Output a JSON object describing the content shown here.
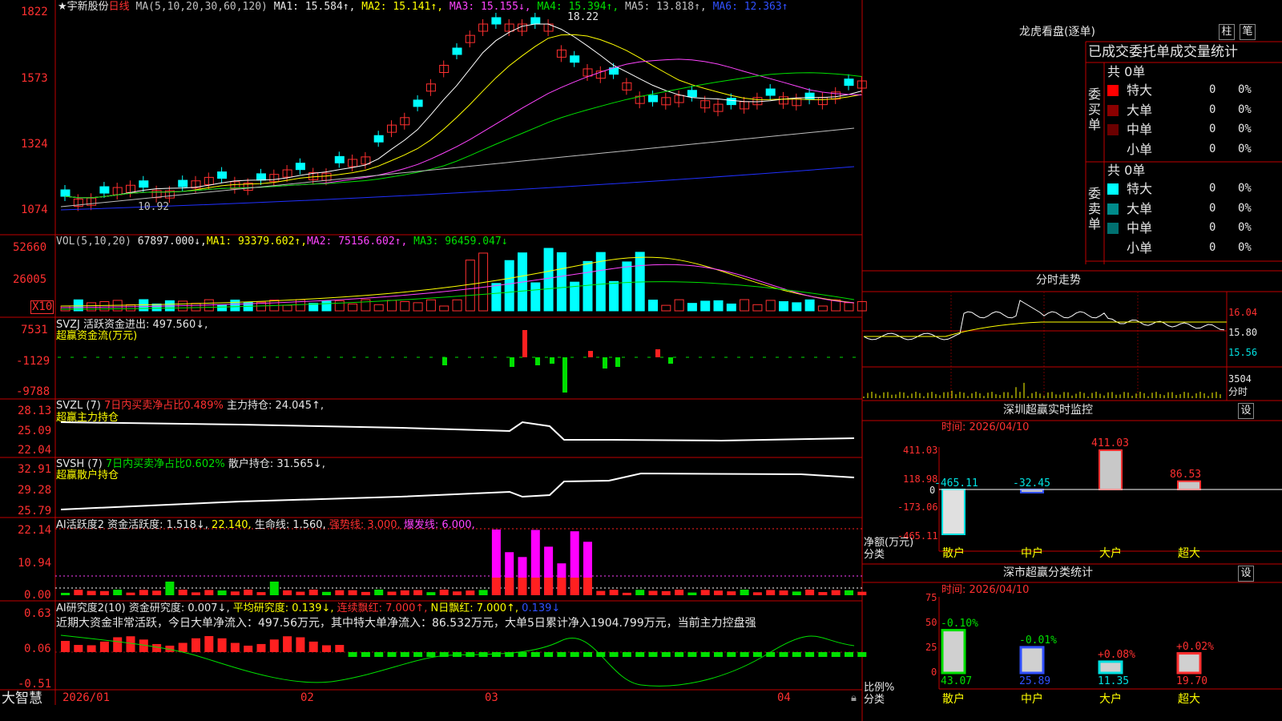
{
  "stock": {
    "name": "★宇新股份",
    "period": "日线",
    "ma_header": "MA(5,10,20,30,60,120)",
    "ma1": "MA1: 15.584↑,",
    "ma2": "MA2: 15.141↑,",
    "ma3": "MA3: 15.155↓,",
    "ma4": "MA4: 15.394↑,",
    "ma5": "MA5: 13.818↑,",
    "ma6": "MA6: 12.363↑",
    "high_label": "18.22",
    "low_label": "10.92",
    "y_ticks": [
      "1822",
      "1573",
      "1324",
      "1074"
    ]
  },
  "volume": {
    "header": "VOL(5,10,20)",
    "val": "67897.000↓,",
    "ma1": "MA1: 93379.602↑,",
    "ma2": "MA2: 75156.602↑,",
    "ma3": "MA3: 96459.047↓",
    "y_ticks": [
      "52660",
      "26005"
    ],
    "unit": "X10"
  },
  "svzj": {
    "header": "SVZJ  活跃资金进出: 497.560↓,",
    "sub": "超赢资金流(万元)",
    "y_ticks": [
      "7531",
      "-1129",
      "-9788"
    ]
  },
  "svzl": {
    "name": "SVZL (7)",
    "ratio": "7日内买卖净占比0.489%",
    "hold": "主力持仓: 24.045↑,",
    "sub": "超赢主力持仓",
    "y_ticks": [
      "28.13",
      "25.09",
      "22.04"
    ]
  },
  "svsh": {
    "name": "SVSH (7)",
    "ratio": "7日内买卖净占比0.602%",
    "hold": "散户持仓: 31.565↓,",
    "sub": "超赢散户持仓",
    "y_ticks": [
      "32.91",
      "29.28",
      "25.79"
    ]
  },
  "ai_active": {
    "name": "AI活跃度2",
    "v1": "资金活跃度: 1.518↓,",
    "v2": "22.140,",
    "v3": "生命线: 1.560,",
    "v4": "强势线: 3.000,",
    "v5": "爆发线: 6.000,",
    "y_ticks": [
      "22.14",
      "10.94",
      "0.00"
    ]
  },
  "ai_research": {
    "name": "AI研究度2(10)",
    "v1": "资金研究度: 0.007↓,",
    "v2": "平均研究度: 0.139↓,",
    "v3": "连续飘红: 7.000↑,",
    "v4": "N日飘红: 7.000↑,",
    "v5": "0.139↓",
    "comment": "近期大资金非常活跃，今日大单净流入：497.56万元，其中特大单净流入：86.532万元，大单5日累计净入1904.799万元，当前主力控盘强",
    "y_ticks": [
      "0.63",
      "0.06",
      "-0.51"
    ]
  },
  "x_axis": {
    "labels": [
      "2026/01",
      "02",
      "03",
      "04"
    ],
    "brand": "大智慧"
  },
  "dragon": {
    "title": "龙虎看盘(逐单)",
    "btn1": "柱",
    "btn2": "笔",
    "header": "已成交委托单成交量统计",
    "buy_label": "委买单",
    "sell_label": "委卖单",
    "buy_total": "共 0单",
    "sell_total": "共 0单",
    "rows": [
      "特大",
      "大单",
      "中单",
      "小单"
    ],
    "zero": "0",
    "pct": "0%",
    "buy_colors": [
      "#ff0000",
      "#8b0000",
      "#6b0000",
      ""
    ],
    "sell_colors": [
      "#00ffff",
      "#008b8b",
      "#007070",
      ""
    ]
  },
  "intraday": {
    "title": "分时走势",
    "prices": [
      "16.04",
      "15.80",
      "15.56"
    ],
    "vol": "3504",
    "vol_unit": "分时"
  },
  "monitor": {
    "title": "深圳超赢实时监控",
    "btn": "设",
    "time": "时间: 2026/04/10",
    "y_ticks": [
      "411.03",
      "118.98",
      "0",
      "-173.06",
      "-465.11"
    ],
    "ylabel": "净额(万元)",
    "xlabel": "分类",
    "categories": [
      "散户",
      "中户",
      "大户",
      "超大"
    ],
    "values": [
      -465.11,
      -32.45,
      411.03,
      86.53
    ],
    "value_labels": [
      "-465.11",
      "-32.45",
      "411.03",
      "86.53"
    ]
  },
  "classify": {
    "title": "深市超赢分类统计",
    "btn": "设",
    "time": "时间: 2026/04/10",
    "y_ticks": [
      "75",
      "50",
      "25",
      "0"
    ],
    "ylabel": "比例%",
    "xlabel": "分类",
    "categories": [
      "散户",
      "中户",
      "大户",
      "超大"
    ],
    "values": [
      43.07,
      25.89,
      11.35,
      19.7
    ],
    "value_labels": [
      "43.07",
      "25.89",
      "11.35",
      "19.70"
    ],
    "change_labels": [
      "-0.10%",
      "-0.01%",
      "+0.08%",
      "+0.02%"
    ]
  },
  "chart_data": [
    {
      "type": "bar",
      "title": "深圳超赢实时监控",
      "ylabel": "净额(万元)",
      "xlabel": "分类",
      "categories": [
        "散户",
        "中户",
        "大户",
        "超大"
      ],
      "values": [
        -465.11,
        -32.45,
        411.03,
        86.53
      ],
      "ylim": [
        -465.11,
        411.03
      ]
    },
    {
      "type": "bar",
      "title": "深市超赢分类统计",
      "ylabel": "比例%",
      "xlabel": "分类",
      "categories": [
        "散户",
        "中户",
        "大户",
        "超大"
      ],
      "values": [
        43.07,
        25.89,
        11.35,
        19.7
      ],
      "ylim": [
        0,
        75
      ]
    }
  ]
}
